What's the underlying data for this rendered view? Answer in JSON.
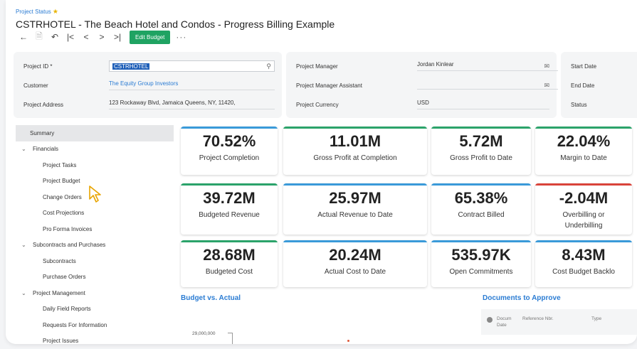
{
  "header": {
    "breadcrumb": "Project Status",
    "title": "CSTRHOTEL - The Beach Hotel and Condos - Progress Billing Example"
  },
  "toolbar": {
    "back": "←",
    "save": "🗎",
    "undo": "↶",
    "first": "|<",
    "prev": "<",
    "next": ">",
    "last": ">|",
    "edit_label": "Edit Budget",
    "more": "···"
  },
  "form1": {
    "project_id_label": "Project ID *",
    "project_id_value": "CSTRHOTEL",
    "customer_label": "Customer",
    "customer_value": "The Equity Group Investors",
    "address_label": "Project Address",
    "address_value": "123 Rockaway Blvd, Jamaica Queens, NY, 11420,"
  },
  "form2": {
    "pm_label": "Project Manager",
    "pm_value": "Jordan Kinlear",
    "pma_label": "Project Manager Assistant",
    "pma_value": "",
    "currency_label": "Project Currency",
    "currency_value": "USD"
  },
  "form3": {
    "start_label": "Start Date",
    "end_label": "End Date",
    "status_label": "Status"
  },
  "nav": [
    {
      "label": "Summary",
      "level": 1,
      "selected": true
    },
    {
      "label": "Financials",
      "level": 0,
      "expanded": true
    },
    {
      "label": "Project Tasks",
      "level": 2
    },
    {
      "label": "Project Budget",
      "level": 2
    },
    {
      "label": "Change Orders",
      "level": 2
    },
    {
      "label": "Cost Projections",
      "level": 2
    },
    {
      "label": "Pro Forma Invoices",
      "level": 2
    },
    {
      "label": "Subcontracts and Purchases",
      "level": 0,
      "expanded": true
    },
    {
      "label": "Subcontracts",
      "level": 2
    },
    {
      "label": "Purchase Orders",
      "level": 2
    },
    {
      "label": "Project Management",
      "level": 0,
      "expanded": true
    },
    {
      "label": "Daily Field Reports",
      "level": 2
    },
    {
      "label": "Requests For Information",
      "level": 2
    },
    {
      "label": "Project Issues",
      "level": 2
    }
  ],
  "kpis": [
    {
      "value": "70.52%",
      "label": "Project Completion",
      "color": "#3a9ad9"
    },
    {
      "value": "11.01M",
      "label": "Gross Profit at Completion",
      "color": "#2ba36a"
    },
    {
      "value": "5.72M",
      "label": "Gross Profit to Date",
      "color": "#2ba36a"
    },
    {
      "value": "22.04%",
      "label": "Margin to Date",
      "color": "#2ba36a"
    },
    {
      "value": "39.72M",
      "label": "Budgeted Revenue",
      "color": "#2ba36a"
    },
    {
      "value": "25.97M",
      "label": "Actual Revenue to Date",
      "color": "#3a9ad9"
    },
    {
      "value": "65.38%",
      "label": "Contract Billed",
      "color": "#3a9ad9"
    },
    {
      "value": "-2.04M",
      "label": "Overbilling or\nUnderbilling",
      "color": "#d9433a"
    },
    {
      "value": "28.68M",
      "label": "Budgeted Cost",
      "color": "#2ba36a"
    },
    {
      "value": "20.24M",
      "label": "Actual Cost to Date",
      "color": "#3a9ad9"
    },
    {
      "value": "535.97K",
      "label": "Open Commitments",
      "color": "#3a9ad9"
    },
    {
      "value": "8.43M",
      "label": "Cost Budget Backlo",
      "color": "#3a9ad9"
    }
  ],
  "sections": {
    "budget_vs_actual": "Budget vs. Actual",
    "documents": "Documents to Approve"
  },
  "docs_table": {
    "col1": "Docum",
    "col1b": "Date",
    "col2": "Reference Nbr.",
    "col3": "Type"
  },
  "chart_data": {
    "type": "bar",
    "title": "Budget vs. Actual",
    "y_tick_top": "29,000,000"
  }
}
